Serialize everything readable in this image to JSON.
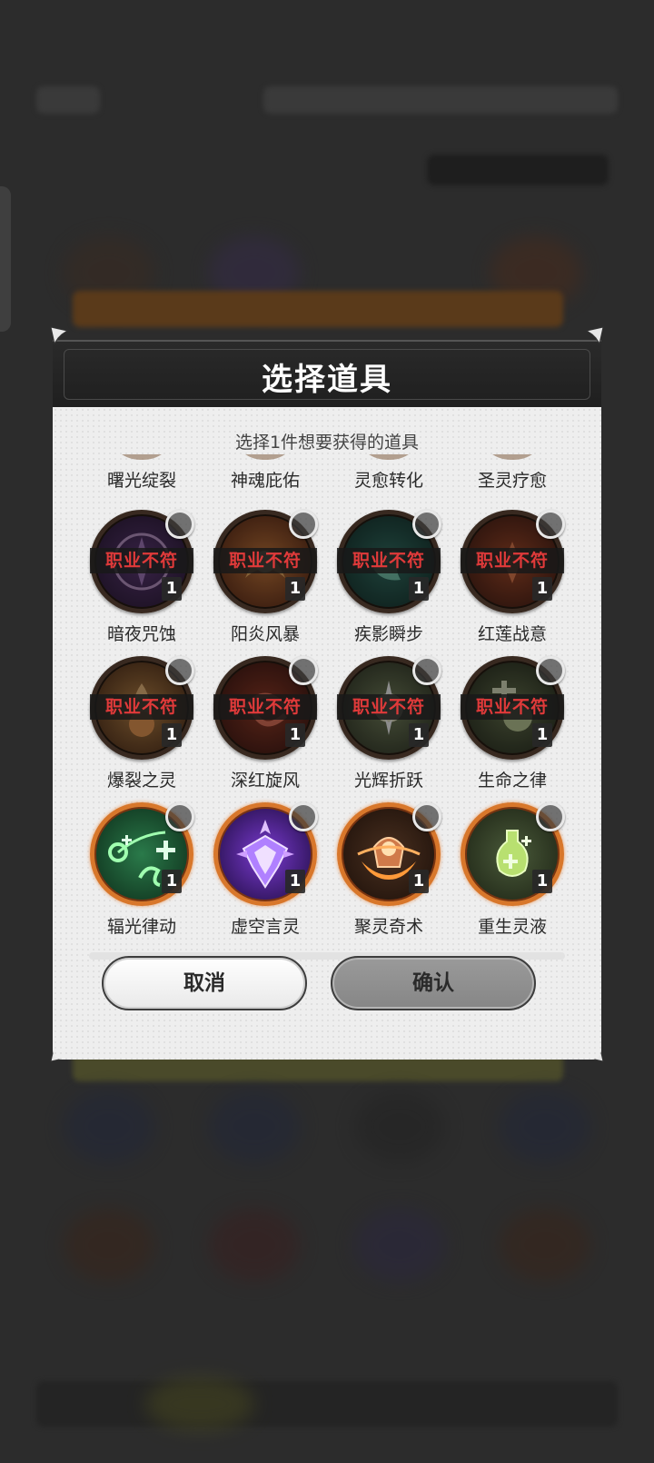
{
  "dialog": {
    "title": "选择道具",
    "subtitle": "选择1件想要获得的道具",
    "cancel_label": "取消",
    "confirm_label": "确认"
  },
  "partial_row": [
    {
      "name": "曙光绽裂"
    },
    {
      "name": "神魂庇佑"
    },
    {
      "name": "灵愈转化"
    },
    {
      "name": "圣灵疗愈"
    }
  ],
  "items": [
    {
      "name": "暗夜咒蚀",
      "restricted": true,
      "restrict_label": "职业不符",
      "qty": "1",
      "icon": "dark-curse-icon"
    },
    {
      "name": "阳炎风暴",
      "restricted": true,
      "restrict_label": "职业不符",
      "qty": "1",
      "icon": "flame-storm-icon"
    },
    {
      "name": "疾影瞬步",
      "restricted": true,
      "restrict_label": "职业不符",
      "qty": "1",
      "icon": "shadow-step-icon"
    },
    {
      "name": "红莲战意",
      "restricted": true,
      "restrict_label": "职业不符",
      "qty": "1",
      "icon": "red-lotus-icon"
    },
    {
      "name": "爆裂之灵",
      "restricted": true,
      "restrict_label": "职业不符",
      "qty": "1",
      "icon": "burst-spirit-icon"
    },
    {
      "name": "深红旋风",
      "restricted": true,
      "restrict_label": "职业不符",
      "qty": "1",
      "icon": "crimson-whirlwind-icon"
    },
    {
      "name": "光辉折跃",
      "restricted": true,
      "restrict_label": "职业不符",
      "qty": "1",
      "icon": "radiant-warp-icon"
    },
    {
      "name": "生命之律",
      "restricted": true,
      "restrict_label": "职业不符",
      "qty": "1",
      "icon": "life-law-icon"
    },
    {
      "name": "辐光律动",
      "restricted": false,
      "restrict_label": "",
      "qty": "1",
      "icon": "radiant-pulse-icon"
    },
    {
      "name": "虚空言灵",
      "restricted": false,
      "restrict_label": "",
      "qty": "1",
      "icon": "void-word-icon"
    },
    {
      "name": "聚灵奇术",
      "restricted": false,
      "restrict_label": "",
      "qty": "1",
      "icon": "spirit-gather-icon"
    },
    {
      "name": "重生灵液",
      "restricted": false,
      "restrict_label": "",
      "qty": "1",
      "icon": "rebirth-potion-icon"
    }
  ],
  "colors": {
    "restricted_text": "#e03a3a",
    "owned_border": "#d8772b"
  }
}
